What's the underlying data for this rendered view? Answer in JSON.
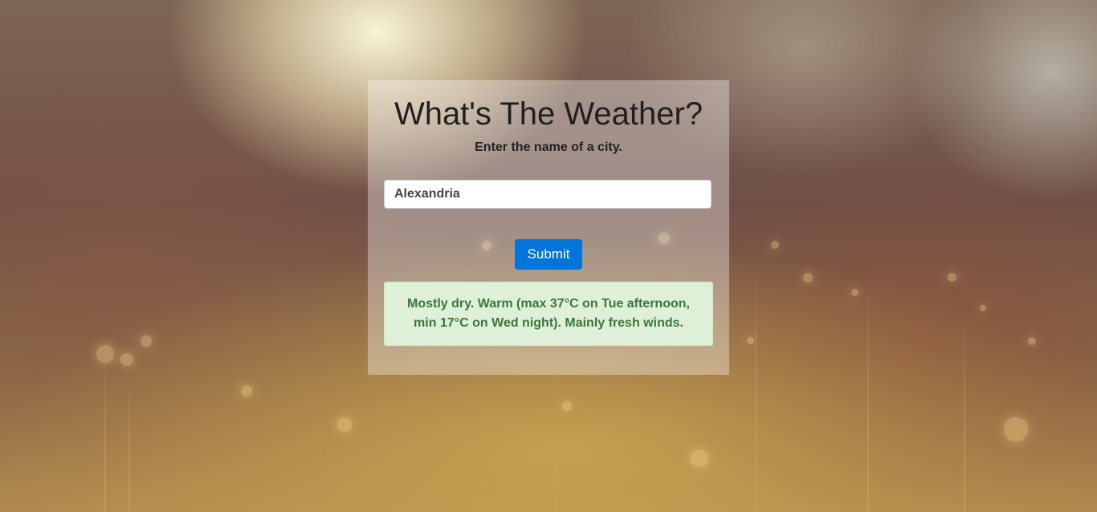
{
  "header": {
    "title": "What's The Weather?",
    "subtitle": "Enter the name of a city."
  },
  "form": {
    "city_value": "Alexandria",
    "submit_label": "Submit"
  },
  "result": {
    "forecast": "Mostly dry. Warm (max 37°C on Tue afternoon, min 17°C on Wed night). Mainly fresh winds."
  },
  "colors": {
    "submit_button": "#0275d8",
    "result_background": "#dff0d8",
    "result_text": "#3c763d"
  }
}
